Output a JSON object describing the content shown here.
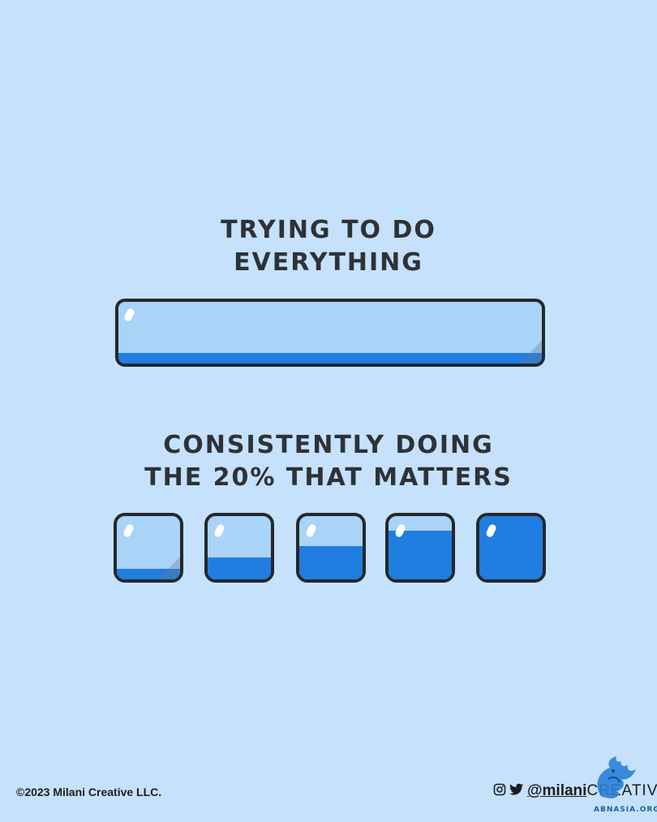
{
  "headings": {
    "top": [
      "TRYING TO DO",
      "EVERYTHING"
    ],
    "bottom": [
      "CONSISTENTLY DOING",
      "THE 20% THAT MATTERS"
    ]
  },
  "colors": {
    "background": "#c5e1fc",
    "empty": "#aad3f8",
    "filled": "#1f7ee0",
    "outline": "#24282c",
    "text": "#2e3236"
  },
  "progress_bar": {
    "fill_fraction": 0.17
  },
  "squares": [
    {
      "fill_fraction": 0.17
    },
    {
      "fill_fraction": 0.35
    },
    {
      "fill_fraction": 0.53
    },
    {
      "fill_fraction": 0.77
    },
    {
      "fill_fraction": 1.0
    }
  ],
  "footer": {
    "copyright": "©2023 Milani Creative LLC.",
    "handle_bold": "@milani",
    "handle_light": "CREATIVE",
    "icons": [
      "instagram-icon",
      "twitter-icon"
    ],
    "watermark_logo": "bird-logo-icon",
    "watermark_text": "ABNASIA.ORG"
  }
}
